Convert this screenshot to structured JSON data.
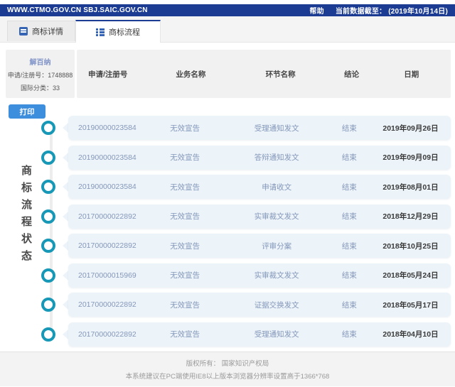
{
  "topbar": {
    "sites": "WWW.CTMO.GOV.CN SBJ.SAIC.GOV.CN",
    "help": "帮助",
    "data_cutoff": "当前数据截至： (2019年10月14日)"
  },
  "tabs": [
    {
      "label": "商标详情",
      "active": false
    },
    {
      "label": "商标流程",
      "active": true
    }
  ],
  "trademark": {
    "name": "解百纳",
    "reg_no": "申请/注册号：1748888",
    "intl_class": "国际分类：33"
  },
  "print_label": "打印",
  "section_title": "商标流程状态",
  "table": {
    "headers": [
      "申请/注册号",
      "业务名称",
      "环节名称",
      "结论",
      "日期"
    ],
    "rows": [
      {
        "app_no": "20190000023584",
        "business": "无效宣告",
        "step": "受理通知发文",
        "result": "结束",
        "date": "2019年09月26日"
      },
      {
        "app_no": "20190000023584",
        "business": "无效宣告",
        "step": "答辩通知发文",
        "result": "结束",
        "date": "2019年09月09日"
      },
      {
        "app_no": "20190000023584",
        "business": "无效宣告",
        "step": "申请收文",
        "result": "结束",
        "date": "2019年08月01日"
      },
      {
        "app_no": "20170000022892",
        "business": "无效宣告",
        "step": "实审裁文发文",
        "result": "结束",
        "date": "2018年12月29日"
      },
      {
        "app_no": "20170000022892",
        "business": "无效宣告",
        "step": "评审分案",
        "result": "结束",
        "date": "2018年10月25日"
      },
      {
        "app_no": "20170000015969",
        "business": "无效宣告",
        "step": "实审裁文发文",
        "result": "结束",
        "date": "2018年05月24日"
      },
      {
        "app_no": "20170000022892",
        "business": "无效宣告",
        "step": "证据交换发文",
        "result": "结束",
        "date": "2018年05月17日"
      },
      {
        "app_no": "20170000022892",
        "business": "无效宣告",
        "step": "受理通知发文",
        "result": "结束",
        "date": "2018年04月10日"
      }
    ]
  },
  "footer": {
    "line1": "版权所有：  国家知识产权局",
    "line2": "本系统建议在PC端使用IE8以上版本浏览器分辨率设置高于1366*768"
  },
  "colors": {
    "topbar_navy": "#1c3c94",
    "timeline_teal": "#1798b6",
    "print_button_blue": "#3e8ede",
    "row_bubble": "#edf4f9",
    "row_text": "#8497ba",
    "header_band": "#f1f1f1"
  }
}
